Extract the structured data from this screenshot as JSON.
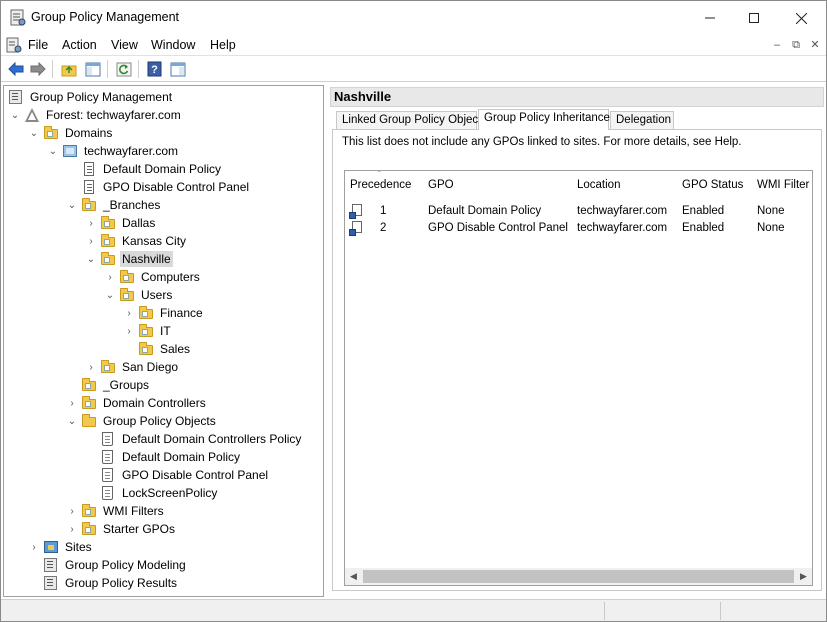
{
  "window": {
    "title": "Group Policy Management",
    "controls": [
      "minimize-icon",
      "maximize-icon",
      "close-icon"
    ]
  },
  "menu": {
    "items": [
      "File",
      "Action",
      "View",
      "Window",
      "Help"
    ],
    "mdi_controls": [
      "minimize-icon",
      "restore-icon",
      "close-icon"
    ]
  },
  "toolbar": {
    "buttons": [
      "back-arrow-icon",
      "forward-arrow-icon",
      "up-folder-icon",
      "show-hide-tree-icon",
      "refresh-icon",
      "help-icon",
      "action-pane-icon"
    ]
  },
  "tree": {
    "root": "Group Policy Management",
    "forest": "Forest: techwayfarer.com",
    "domains": "Domains",
    "domain": "techwayfarer.com",
    "default_domain_policy": "Default Domain Policy",
    "gpo_disable_cp": "GPO Disable Control Panel",
    "branches": "_Branches",
    "dallas": "Dallas",
    "kansas_city": "Kansas City",
    "nashville": "Nashville",
    "computers": "Computers",
    "users": "Users",
    "finance": "Finance",
    "it": "IT",
    "sales": "Sales",
    "san_diego": "San Diego",
    "groups": "_Groups",
    "domain_controllers": "Domain Controllers",
    "gpo_container": "Group Policy Objects",
    "gpo_ddcp": "Default Domain Controllers Policy",
    "gpo_ddp": "Default Domain Policy",
    "gpo_dcp": "GPO Disable Control Panel",
    "gpo_lock": "LockScreenPolicy",
    "wmi_filters": "WMI Filters",
    "starter_gpos": "Starter GPOs",
    "sites": "Sites",
    "modeling": "Group Policy Modeling",
    "results": "Group Policy Results"
  },
  "right": {
    "header": "Nashville",
    "tabs": [
      "Linked Group Policy Objects",
      "Group Policy Inheritance",
      "Delegation"
    ],
    "active_tab": "Group Policy Inheritance",
    "info": "This list does not include any GPOs linked to sites. For more details, see Help.",
    "columns": [
      "Precedence",
      "GPO",
      "Location",
      "GPO Status",
      "WMI Filter"
    ],
    "rows": [
      {
        "precedence": "1",
        "gpo": "Default Domain Policy",
        "location": "techwayfarer.com",
        "status": "Enabled",
        "wmi": "None"
      },
      {
        "precedence": "2",
        "gpo": "GPO Disable Control Panel",
        "location": "techwayfarer.com",
        "status": "Enabled",
        "wmi": "None"
      }
    ]
  },
  "colors": {
    "folder": "#f2c94c",
    "back_arrow": "#2f6fd0",
    "selected": "#d9d9d9"
  }
}
